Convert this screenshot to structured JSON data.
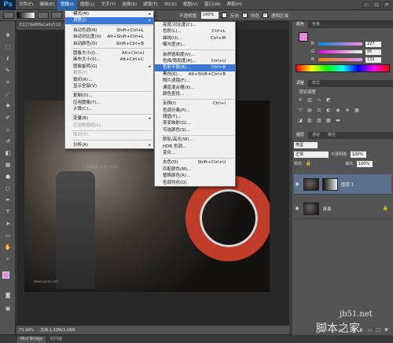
{
  "app_logo": "Ps",
  "menubar": [
    "文件(F)",
    "编辑(E)",
    "图像(I)",
    "图层(L)",
    "文字(Y)",
    "选择(S)",
    "滤镜(T)",
    "3D(D)",
    "视图(V)",
    "窗口(W)",
    "帮助(H)"
  ],
  "menubar_active_index": 2,
  "options": {
    "opacity_label": "不透明度:",
    "opacity_value": "100%",
    "reverse_label": "反向",
    "dither_label": "仿色",
    "transparency_label": "透明区域"
  },
  "document_tab": "E2279e8f8e1a6c510",
  "image_menu": [
    {
      "label": "模式(M)",
      "shortcut": "",
      "arrow": true
    },
    {
      "label": "调整(J)",
      "shortcut": "",
      "arrow": true,
      "highlight": true
    },
    {
      "sep": true
    },
    {
      "label": "自动色调(N)",
      "shortcut": "Shift+Ctrl+L"
    },
    {
      "label": "自动对比度(U)",
      "shortcut": "Alt+Shift+Ctrl+L"
    },
    {
      "label": "自动颜色(O)",
      "shortcut": "Shift+Ctrl+B"
    },
    {
      "sep": true
    },
    {
      "label": "图像大小(I)...",
      "shortcut": "Alt+Ctrl+I"
    },
    {
      "label": "画布大小(S)...",
      "shortcut": "Alt+Ctrl+C"
    },
    {
      "label": "图像旋转(G)",
      "shortcut": "",
      "arrow": true
    },
    {
      "label": "裁剪(P)",
      "shortcut": "",
      "disabled": true
    },
    {
      "label": "裁切(R)...",
      "shortcut": ""
    },
    {
      "label": "显示全部(V)",
      "shortcut": ""
    },
    {
      "sep": true
    },
    {
      "label": "复制(D)...",
      "shortcut": ""
    },
    {
      "label": "应用图像(Y)...",
      "shortcut": ""
    },
    {
      "label": "计算(C)...",
      "shortcut": ""
    },
    {
      "sep": true
    },
    {
      "label": "变量(B)",
      "shortcut": "",
      "arrow": true
    },
    {
      "label": "应用数据组(L)...",
      "shortcut": "",
      "disabled": true
    },
    {
      "sep": true
    },
    {
      "label": "陷印(T)...",
      "shortcut": "",
      "disabled": true
    },
    {
      "sep": true
    },
    {
      "label": "分析(A)",
      "shortcut": "",
      "arrow": true
    }
  ],
  "adjust_menu": [
    {
      "label": "亮度/对比度(C)...",
      "shortcut": ""
    },
    {
      "label": "色阶(L)...",
      "shortcut": "Ctrl+L"
    },
    {
      "label": "曲线(U)...",
      "shortcut": "Ctrl+M"
    },
    {
      "label": "曝光度(E)...",
      "shortcut": ""
    },
    {
      "sep": true
    },
    {
      "label": "自然饱和度(V)...",
      "shortcut": ""
    },
    {
      "label": "色相/饱和度(H)...",
      "shortcut": "Ctrl+U"
    },
    {
      "label": "色彩平衡(B)...",
      "shortcut": "Ctrl+B",
      "highlight": true
    },
    {
      "label": "黑白(K)...",
      "shortcut": "Alt+Shift+Ctrl+B"
    },
    {
      "label": "照片滤镜(F)...",
      "shortcut": ""
    },
    {
      "label": "通道混合器(X)...",
      "shortcut": ""
    },
    {
      "label": "颜色查找...",
      "shortcut": ""
    },
    {
      "sep": true
    },
    {
      "label": "反相(I)",
      "shortcut": "Ctrl+I"
    },
    {
      "label": "色调分离(P)...",
      "shortcut": ""
    },
    {
      "label": "阈值(T)...",
      "shortcut": ""
    },
    {
      "label": "渐变映射(G)...",
      "shortcut": ""
    },
    {
      "label": "可选颜色(S)...",
      "shortcut": ""
    },
    {
      "sep": true
    },
    {
      "label": "阴影/高光(W)...",
      "shortcut": ""
    },
    {
      "label": "HDR 色调...",
      "shortcut": ""
    },
    {
      "label": "变化...",
      "shortcut": ""
    },
    {
      "sep": true
    },
    {
      "label": "去色(D)",
      "shortcut": "Shift+Ctrl+U"
    },
    {
      "label": "匹配颜色(M)...",
      "shortcut": ""
    },
    {
      "label": "替换颜色(R)...",
      "shortcut": ""
    },
    {
      "label": "色调均化(Q)",
      "shortcut": ""
    }
  ],
  "color_panel": {
    "tabs": [
      "颜色",
      "色板"
    ],
    "r": "227",
    "g": "95",
    "b": "132",
    "fg_color": "#e58ae0"
  },
  "adjust_panel": {
    "tabs": [
      "调整",
      "样式"
    ],
    "title": "添加调整"
  },
  "layers_panel": {
    "tabs": [
      "图层",
      "通道",
      "路径"
    ],
    "kind_label": "类型",
    "blend_mode": "正常",
    "opacity_label": "不透明度:",
    "opacity_value": "100%",
    "lock_label": "锁定:",
    "fill_label": "填充:",
    "fill_value": "100%",
    "layers": [
      {
        "name": "图层 1",
        "selected": true,
        "has_mask": true
      },
      {
        "name": "背景",
        "selected": false,
        "has_mask": false
      }
    ]
  },
  "photo_text": "NEVER LOOK BACK",
  "photo_watermark": "www.sucai.com",
  "status": {
    "zoom": "73.94%",
    "doc": "文档:1.32M/3.06M"
  },
  "bottom_tabs": [
    "Mini Bridge",
    "时间轴"
  ],
  "site_watermark": {
    "line1": "jb51.net",
    "line2": "脚本之家"
  }
}
